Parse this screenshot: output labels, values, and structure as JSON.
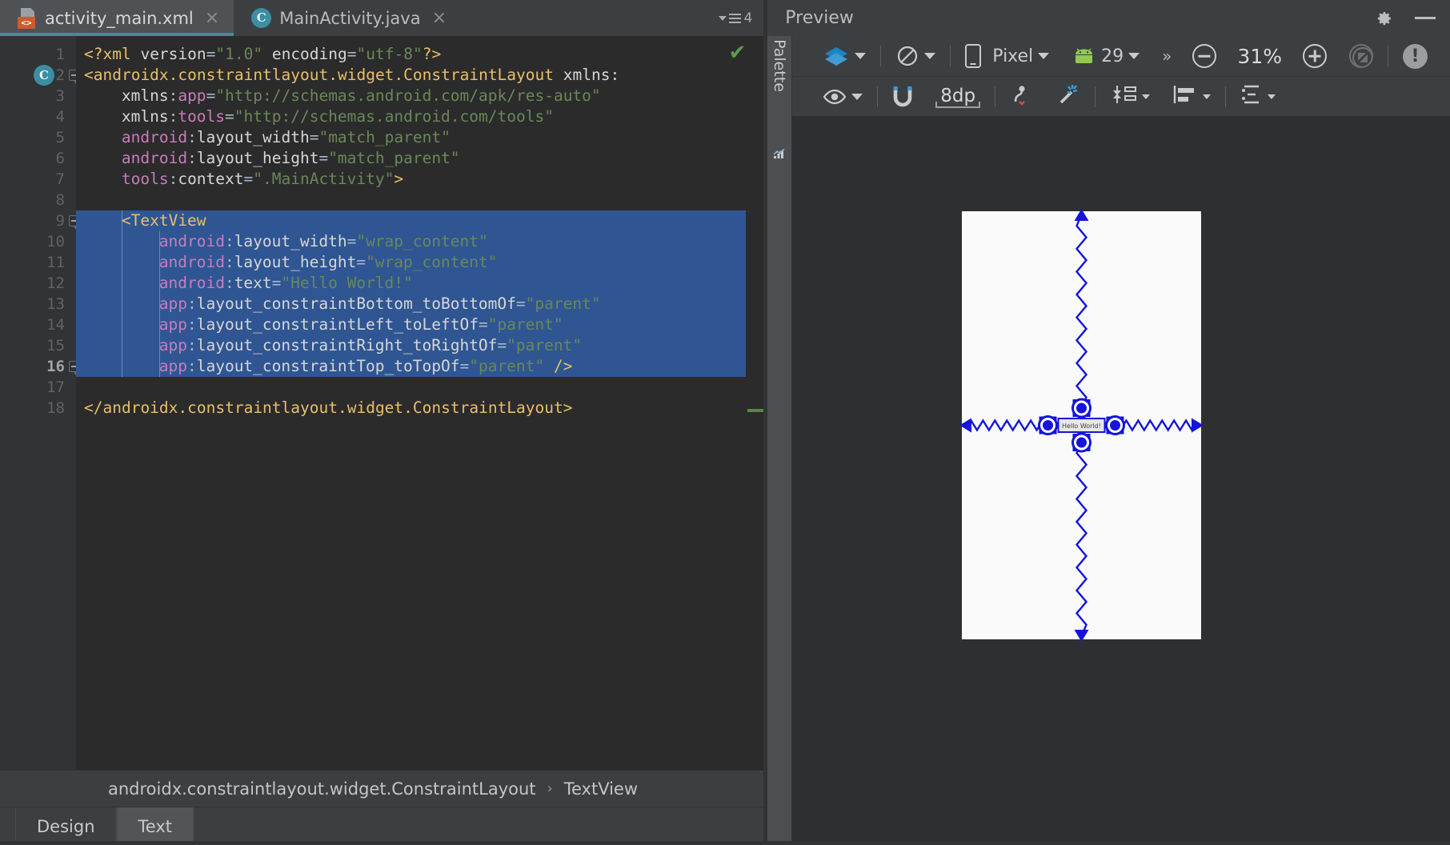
{
  "editor": {
    "tabs": [
      {
        "label": "activity_main.xml",
        "icon": "xml-file-icon",
        "active": true,
        "close": "×"
      },
      {
        "label": "MainActivity.java",
        "icon": "java-class-icon",
        "active": false,
        "close": "×"
      }
    ],
    "tab_overflow_count": "4",
    "gutter_marker_letter": "C",
    "status_check": "✔",
    "line_count": 18,
    "lines": [
      {
        "n": "1",
        "tokens": [
          {
            "t": "<?xml ",
            "c": "tok-tag"
          },
          {
            "t": "version",
            "c": "tok-white"
          },
          {
            "t": "=",
            "c": "tok-punct"
          },
          {
            "t": "\"1.0\"",
            "c": "tok-str"
          },
          {
            "t": " encoding",
            "c": "tok-white"
          },
          {
            "t": "=",
            "c": "tok-punct"
          },
          {
            "t": "\"utf-8\"",
            "c": "tok-str"
          },
          {
            "t": "?>",
            "c": "tok-tag"
          }
        ]
      },
      {
        "n": "2",
        "tokens": [
          {
            "t": "<androidx.constraintlayout.widget.ConstraintLayout",
            "c": "tok-tag"
          },
          {
            "t": " xmlns:",
            "c": "tok-white"
          }
        ]
      },
      {
        "n": "3",
        "indent": 4,
        "tokens": [
          {
            "t": "xmlns",
            "c": "tok-white"
          },
          {
            "t": ":",
            "c": "tok-punct"
          },
          {
            "t": "app",
            "c": "tok-ns"
          },
          {
            "t": "=",
            "c": "tok-punct"
          },
          {
            "t": "\"http://schemas.android.com/apk/res-auto\"",
            "c": "tok-str"
          }
        ]
      },
      {
        "n": "4",
        "indent": 4,
        "tokens": [
          {
            "t": "xmlns",
            "c": "tok-white"
          },
          {
            "t": ":",
            "c": "tok-punct"
          },
          {
            "t": "tools",
            "c": "tok-ns"
          },
          {
            "t": "=",
            "c": "tok-punct"
          },
          {
            "t": "\"http://schemas.android.com/tools\"",
            "c": "tok-str"
          }
        ]
      },
      {
        "n": "5",
        "indent": 4,
        "tokens": [
          {
            "t": "android",
            "c": "tok-ns"
          },
          {
            "t": ":",
            "c": "tok-punct"
          },
          {
            "t": "layout_width",
            "c": "tok-white"
          },
          {
            "t": "=",
            "c": "tok-punct"
          },
          {
            "t": "\"match_parent\"",
            "c": "tok-str"
          }
        ]
      },
      {
        "n": "6",
        "indent": 4,
        "tokens": [
          {
            "t": "android",
            "c": "tok-ns"
          },
          {
            "t": ":",
            "c": "tok-punct"
          },
          {
            "t": "layout_height",
            "c": "tok-white"
          },
          {
            "t": "=",
            "c": "tok-punct"
          },
          {
            "t": "\"match_parent\"",
            "c": "tok-str"
          }
        ]
      },
      {
        "n": "7",
        "indent": 4,
        "tokens": [
          {
            "t": "tools",
            "c": "tok-ns"
          },
          {
            "t": ":",
            "c": "tok-punct"
          },
          {
            "t": "context",
            "c": "tok-white"
          },
          {
            "t": "=",
            "c": "tok-punct"
          },
          {
            "t": "\".MainActivity\"",
            "c": "tok-str"
          },
          {
            "t": ">",
            "c": "tok-tag"
          }
        ]
      },
      {
        "n": "8",
        "tokens": []
      },
      {
        "n": "9",
        "selected": true,
        "indent": 4,
        "tokens": [
          {
            "t": "<TextView",
            "c": "tok-tag"
          }
        ]
      },
      {
        "n": "10",
        "selected": true,
        "indent": 8,
        "tokens": [
          {
            "t": "android",
            "c": "tok-ns"
          },
          {
            "t": ":",
            "c": "tok-punct"
          },
          {
            "t": "layout_width",
            "c": "tok-white"
          },
          {
            "t": "=",
            "c": "tok-punct"
          },
          {
            "t": "\"wrap_content\"",
            "c": "tok-str"
          }
        ]
      },
      {
        "n": "11",
        "selected": true,
        "indent": 8,
        "tokens": [
          {
            "t": "android",
            "c": "tok-ns"
          },
          {
            "t": ":",
            "c": "tok-punct"
          },
          {
            "t": "layout_height",
            "c": "tok-white"
          },
          {
            "t": "=",
            "c": "tok-punct"
          },
          {
            "t": "\"wrap_content\"",
            "c": "tok-str"
          }
        ]
      },
      {
        "n": "12",
        "selected": true,
        "indent": 8,
        "tokens": [
          {
            "t": "android",
            "c": "tok-ns"
          },
          {
            "t": ":",
            "c": "tok-punct"
          },
          {
            "t": "text",
            "c": "tok-white"
          },
          {
            "t": "=",
            "c": "tok-punct"
          },
          {
            "t": "\"Hello World!\"",
            "c": "tok-str"
          }
        ]
      },
      {
        "n": "13",
        "selected": true,
        "indent": 8,
        "tokens": [
          {
            "t": "app",
            "c": "tok-ns"
          },
          {
            "t": ":",
            "c": "tok-punct"
          },
          {
            "t": "layout_constraintBottom_toBottomOf",
            "c": "tok-white"
          },
          {
            "t": "=",
            "c": "tok-punct"
          },
          {
            "t": "\"parent\"",
            "c": "tok-str"
          }
        ]
      },
      {
        "n": "14",
        "selected": true,
        "indent": 8,
        "tokens": [
          {
            "t": "app",
            "c": "tok-ns"
          },
          {
            "t": ":",
            "c": "tok-punct"
          },
          {
            "t": "layout_constraintLeft_toLeftOf",
            "c": "tok-white"
          },
          {
            "t": "=",
            "c": "tok-punct"
          },
          {
            "t": "\"parent\"",
            "c": "tok-str"
          }
        ]
      },
      {
        "n": "15",
        "selected": true,
        "indent": 8,
        "tokens": [
          {
            "t": "app",
            "c": "tok-ns"
          },
          {
            "t": ":",
            "c": "tok-punct"
          },
          {
            "t": "layout_constraintRight_toRightOf",
            "c": "tok-white"
          },
          {
            "t": "=",
            "c": "tok-punct"
          },
          {
            "t": "\"parent\"",
            "c": "tok-str"
          }
        ]
      },
      {
        "n": "16",
        "selected": true,
        "current": true,
        "indent": 8,
        "tokens": [
          {
            "t": "app",
            "c": "tok-ns"
          },
          {
            "t": ":",
            "c": "tok-punct"
          },
          {
            "t": "layout_constraintTop_toTopOf",
            "c": "tok-white"
          },
          {
            "t": "=",
            "c": "tok-punct"
          },
          {
            "t": "\"parent\"",
            "c": "tok-str"
          },
          {
            "t": " ",
            "c": "tok-white"
          },
          {
            "t": "/>",
            "c": "tok-tag"
          }
        ]
      },
      {
        "n": "17",
        "tokens": []
      },
      {
        "n": "18",
        "tokens": [
          {
            "t": "</androidx.constraintlayout.widget.ConstraintLayout>",
            "c": "tok-tag"
          }
        ]
      }
    ],
    "breadcrumb": {
      "root": "androidx.constraintlayout.widget.ConstraintLayout",
      "separator": "›",
      "leaf": "TextView"
    },
    "bottom_tabs": [
      {
        "label": "Design",
        "active": false
      },
      {
        "label": "Text",
        "active": true
      }
    ]
  },
  "preview": {
    "title": "Preview",
    "header_icons": [
      {
        "name": "gear-icon"
      },
      {
        "name": "minimize-icon"
      }
    ],
    "palette_rail": {
      "label": "Palette"
    },
    "toolbar_row1": {
      "design_mode_label": "",
      "orientation_label": "",
      "device_label": "Pixel",
      "api_label": "29",
      "overflow_label": "»",
      "zoom_out_label": "−",
      "zoom_level": "31%",
      "zoom_in_label": "+",
      "zoom_fit_label": "",
      "issue_badge_label": "!"
    },
    "toolbar_row2": {
      "visibility_label": "",
      "magnet_label": "",
      "default_margin": "8dp",
      "clear_constraints_label": "",
      "infer_constraints_label": "",
      "pack_label": "",
      "align_label": "",
      "guidelines_label": ""
    },
    "canvas": {
      "widget_text": "Hello World!",
      "constraint_color": "#1414dc",
      "device_bg": "#fafafa",
      "surface_bg": "#2d2f30"
    }
  },
  "colors": {
    "chrome": "#3c3f41",
    "editor_bg": "#2b2b2b",
    "gutter_bg": "#313335",
    "selection": "#2f5693",
    "tab_active": "#4e5254",
    "tab_underline": "#4a8a9a",
    "accent_blue": "#3c8ea3",
    "android_green": "#93c951",
    "xml_orange": "#cc5d2a",
    "string_green": "#6a8759",
    "tag_gold": "#e8bf6a",
    "ns_purple": "#c77dbb"
  }
}
